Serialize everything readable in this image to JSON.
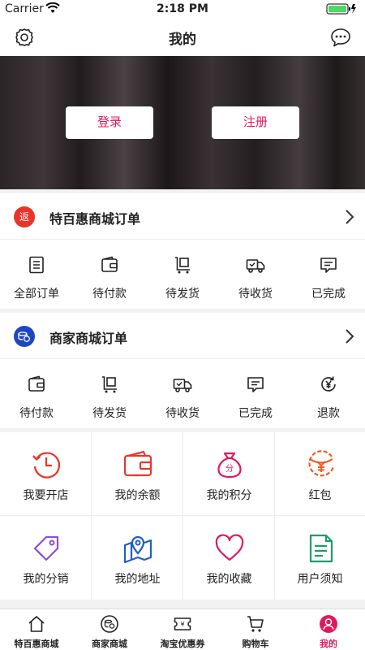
{
  "status_bar": {
    "carrier": "Carrier",
    "time": "2:18 PM"
  },
  "nav": {
    "title": "我的",
    "left_icon": "settings-gear-icon",
    "right_icon": "message-bubble-icon"
  },
  "banner": {
    "login_label": "登录",
    "register_label": "注册"
  },
  "section1": {
    "badge": "返",
    "badge_color": "#e8352b",
    "title": "特百惠商城订单",
    "items": [
      {
        "label": "全部订单",
        "icon": "document-list-icon"
      },
      {
        "label": "待付款",
        "icon": "wallet-icon"
      },
      {
        "label": "待发货",
        "icon": "cart-box-icon"
      },
      {
        "label": "待收货",
        "icon": "delivery-truck-icon"
      },
      {
        "label": "已完成",
        "icon": "message-check-icon"
      }
    ]
  },
  "section2": {
    "badge_color": "#1f47c4",
    "title": "商家商城订单",
    "items": [
      {
        "label": "待付款",
        "icon": "wallet-icon"
      },
      {
        "label": "待发货",
        "icon": "cart-box-icon"
      },
      {
        "label": "待收货",
        "icon": "delivery-truck-icon"
      },
      {
        "label": "已完成",
        "icon": "message-check-icon"
      },
      {
        "label": "退款",
        "icon": "yen-refund-icon"
      }
    ]
  },
  "grid": [
    {
      "label": "我要开店",
      "icon": "clock-icon",
      "color": "#e8352b"
    },
    {
      "label": "我的余额",
      "icon": "wallet-icon",
      "color": "#e8352b"
    },
    {
      "label": "我的积分",
      "icon": "money-bag-icon",
      "color": "#e0195c"
    },
    {
      "label": "红包",
      "icon": "red-envelope-icon",
      "color": "#f05a1e"
    },
    {
      "label": "我的分销",
      "icon": "tag-icon",
      "color": "#8a4fd6"
    },
    {
      "label": "我的地址",
      "icon": "map-pin-icon",
      "color": "#1f5fc4"
    },
    {
      "label": "我的收藏",
      "icon": "heart-icon",
      "color": "#e0195c"
    },
    {
      "label": "用户须知",
      "icon": "document-icon",
      "color": "#1e9c6b"
    }
  ],
  "tabs": [
    {
      "label": "特百惠商城",
      "icon": "home-icon"
    },
    {
      "label": "商家商城",
      "icon": "shop-coin-icon"
    },
    {
      "label": "淘宝优惠券",
      "icon": "coupon-icon"
    },
    {
      "label": "购物车",
      "icon": "cart-icon"
    },
    {
      "label": "我的",
      "icon": "user-icon",
      "active": true
    }
  ],
  "accent_color": "#e0195c"
}
